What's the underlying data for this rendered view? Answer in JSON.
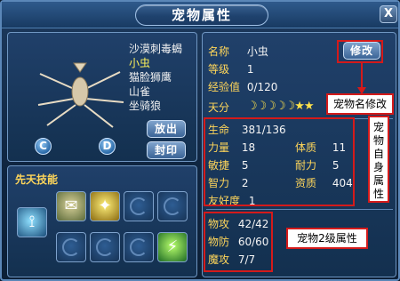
{
  "window": {
    "title": "宠物属性",
    "close_label": "X"
  },
  "pet_list": [
    "沙漠刺毒蝎",
    "小虫",
    "猫脸狮鹰",
    "山雀",
    "坐骑狼"
  ],
  "pet_list_selected_index": 1,
  "pet_controls": {
    "rotate_left_label": "C",
    "rotate_right_label": "D",
    "release_label": "放出",
    "seal_label": "封印"
  },
  "skills": {
    "title": "先天技能",
    "row1": [
      "paper-scroll-icon",
      "gold-claw-icon",
      "empty-slot-icon",
      "empty-slot-icon"
    ],
    "row2": [
      "empty-slot-icon",
      "empty-slot-icon",
      "empty-slot-icon",
      "green-lightning-icon"
    ],
    "talent_icon": "talent-scroll-icon"
  },
  "info": {
    "name_label": "名称",
    "name_value": "小虫",
    "level_label": "等级",
    "level_value": "1",
    "exp_label": "经验值",
    "exp_value": "0/120",
    "talent_label": "天分",
    "talent_stars": "☽☽☽☽☽★★",
    "rename_button": "修改"
  },
  "self_attrs": {
    "life_label": "生命",
    "life_value": "381/136",
    "power_label": "力量",
    "power_value": "18",
    "physique_label": "体质",
    "physique_value": "11",
    "agility_label": "敏捷",
    "agility_value": "5",
    "endurance_label": "耐力",
    "endurance_value": "5",
    "intellect_label": "智力",
    "intellect_value": "2",
    "aptitude_label": "资质",
    "aptitude_value": "404",
    "friendship_label": "友好度",
    "friendship_value": "1"
  },
  "secondary_attrs": {
    "patk_label": "物攻",
    "patk_value": "42/42",
    "pdef_label": "物防",
    "pdef_value": "60/60",
    "matk_label": "魔攻",
    "matk_value": "7/7"
  },
  "annotations": {
    "rename": "宠物名修改",
    "self_attrs": [
      "宠",
      "物",
      "自",
      "身",
      "属",
      "性"
    ],
    "secondary": "宠物2级属性"
  },
  "colors": {
    "label": "#ffd65a",
    "selected": "#fff35a",
    "annotation_border": "#d41a1a"
  }
}
